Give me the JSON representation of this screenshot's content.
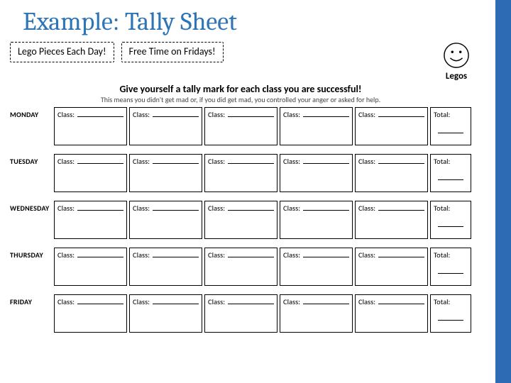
{
  "slide": {
    "title": "Example: Tally Sheet"
  },
  "tags": {
    "left": "Lego Pieces Each Day!",
    "right": "Free Time on Fridays!"
  },
  "instructions": {
    "main": "Give yourself a tally mark for each class you are successful!",
    "sub": "This means you didn't get mad or, if you did get mad, you controlled your anger or asked for help."
  },
  "smiley": {
    "label": "Legos"
  },
  "labels": {
    "class": "Class:",
    "total": "Total:"
  },
  "days": [
    "MONDAY",
    "TUESDAY",
    "WEDNESDAY",
    "THURSDAY",
    "FRIDAY"
  ],
  "classes_per_day": 5
}
